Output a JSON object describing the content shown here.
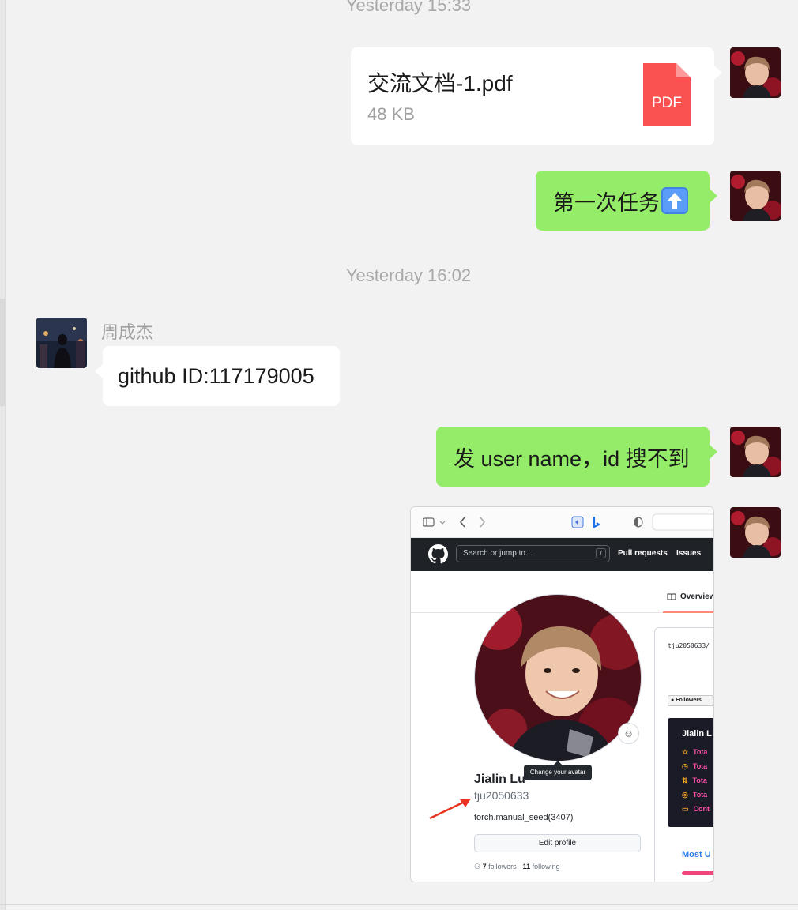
{
  "timestamps": [
    "Yesterday 15:33",
    "Yesterday 16:02"
  ],
  "file_message": {
    "file_name": "交流文档-1.pdf",
    "file_size": "48 KB",
    "icon_label": "PDF",
    "icon_color": "#fa5151"
  },
  "messages": [
    {
      "text": "第一次任务",
      "emoji": "up-arrow-emoji"
    },
    {
      "text": "github ID:117179005"
    },
    {
      "text": "发 user name，id 搜不到"
    }
  ],
  "contact": {
    "name": "周成杰"
  },
  "colors": {
    "self_bubble": "#95ec69",
    "other_bubble": "#ffffff",
    "background": "#f2f2f2"
  },
  "screenshot": {
    "search_placeholder": "Search or jump to...",
    "search_shortcut": "/",
    "nav_pull_requests": "Pull requests",
    "nav_issues": "Issues",
    "tab_overview": "Overview",
    "tooltip": "Change your avatar",
    "full_name": "Jialin Lu",
    "username": "tju2050633",
    "bio": "torch.manual_seed(3407)",
    "edit_profile": "Edit profile",
    "followers_count": "7",
    "followers_label": "followers",
    "following_count": "11",
    "following_label": "following",
    "repo_text": "tju2050633/",
    "followers_badge": "Followers",
    "stats_title": "Jialin L",
    "stats_rows": [
      "Tota",
      "Tota",
      "Tota",
      "Tota",
      "Cont"
    ],
    "most_used": "Most U"
  }
}
